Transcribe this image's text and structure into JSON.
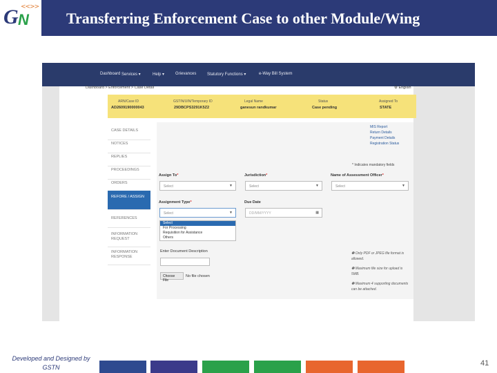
{
  "slide": {
    "title": "Transferring Enforcement Case to other Module/Wing",
    "logo_letters_g": "G",
    "logo_letters_n": "N",
    "logo_arrows": "<<>>",
    "footer_credit": "Developed and Designed by GSTN",
    "page_number": "41",
    "colors": {
      "header": "#2c3a78",
      "bar1": "#2e4a8f",
      "bar2": "#3b3a8a",
      "bar3": "#2aa14a",
      "bar4": "#2aa14a",
      "bar5": "#e8662e",
      "bar6": "#e8662e"
    }
  },
  "portal": {
    "nav": [
      "Dashboard",
      "Services ▾",
      "Help ▾",
      "Grievances",
      "Statutory Functions ▾",
      "e-Way Bill System"
    ],
    "breadcrumb": "Dashboard > Enforcement > Case Detail",
    "language": "⚙ English",
    "case": {
      "headers": [
        "ARN/Case ID",
        "GSTIN/UIN/Temporary ID",
        "Legal Name",
        "Status",
        "Assigned To"
      ],
      "values": [
        "AD2609190000043",
        "29DBCPS3291K5Z2",
        "ganesun randkumar",
        "Case pending",
        "STATE"
      ]
    },
    "sidebar": [
      "CASE DETAILS",
      "NOTICES",
      "REPLIES",
      "PROCEEDINGS",
      "ORDERS",
      "REFORE / ASSIGN",
      "REFERENCES",
      "INFORMATION REQUEST",
      "INFORMATION RESPONSE"
    ],
    "links": [
      "MIS Report",
      "Return Details",
      "Payment Details",
      "Registration Status"
    ],
    "mandatory_note": "* Indicates mandatory fields",
    "assign_to": {
      "label": "Assign To",
      "value": "Select"
    },
    "jurisdiction": {
      "label": "Jurisdiction",
      "value": "Select"
    },
    "officer": {
      "label": "Name of Assessment Officer",
      "value": "Select"
    },
    "assignment_type": {
      "label": "Assignment Type",
      "value": "Select",
      "options": [
        "Select",
        "For Processing",
        "Requisition for Assistance",
        "Others"
      ]
    },
    "due_date": {
      "label": "Due Date",
      "placeholder": "DD/MM/YYYY"
    },
    "document_label": "Enter Document Description",
    "choose_file": "Choose File",
    "no_file": "No file chosen",
    "notes": [
      "Only PDF or JPEG file format is allowed.",
      "Maximum file size for upload is 5MB.",
      "Maximum 4 supporting documents can be attached."
    ]
  }
}
